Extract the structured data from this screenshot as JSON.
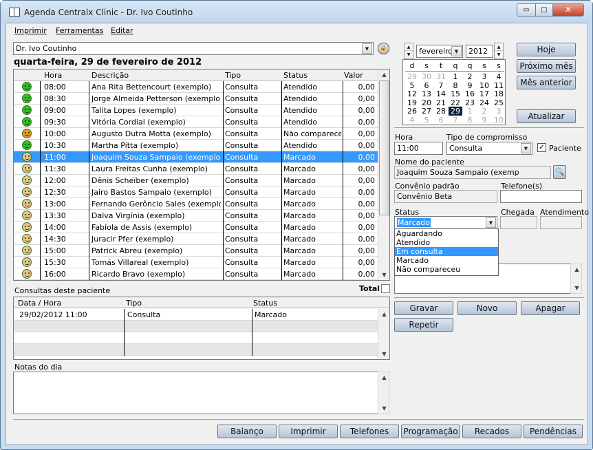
{
  "window": {
    "title": "Agenda Centralx Clinic -  Dr. Ivo Coutinho",
    "min_glyph": "▭",
    "max_glyph": "□",
    "close_glyph": "✕"
  },
  "menu": [
    "Imprimir",
    "Ferramentas",
    "Editar"
  ],
  "doctor_select": {
    "value": "Dr. Ivo Coutinho"
  },
  "date_heading": "quarta-feira, 29 de fevereiro de 2012",
  "appointments": {
    "columns": [
      "Hora",
      "Descrição",
      "Tipo",
      "Status",
      "Valor"
    ],
    "rows": [
      {
        "mood": "green",
        "hora": "08:00",
        "descricao": "Ana Rita Bettencourt (exemplo)",
        "tipo": "Consulta",
        "status": "Atendido",
        "valor": "0,00"
      },
      {
        "mood": "green",
        "hora": "08:30",
        "descricao": "Jorge Almeida Petterson (exemplo)",
        "tipo": "Consulta",
        "status": "Atendido",
        "valor": "0,00"
      },
      {
        "mood": "green",
        "hora": "09:00",
        "descricao": "Talita Lopes (exemplo)",
        "tipo": "Consulta",
        "status": "Atendido",
        "valor": "0,00"
      },
      {
        "mood": "green",
        "hora": "09:30",
        "descricao": "Vitória Cordial (exemplo)",
        "tipo": "Consulta",
        "status": "Atendido",
        "valor": "0,00"
      },
      {
        "mood": "orange",
        "hora": "10:00",
        "descricao": "Augusto Dutra Motta (exemplo)",
        "tipo": "Consulta",
        "status": "Não comparece",
        "valor": "0,00"
      },
      {
        "mood": "green",
        "hora": "10:30",
        "descricao": "Martha Pitta (exemplo)",
        "tipo": "Consulta",
        "status": "Atendido",
        "valor": "0,00"
      },
      {
        "mood": "beige",
        "hora": "11:00",
        "descricao": "Joaquim Souza Sampaio (exemplo)",
        "tipo": "Consulta",
        "status": "Marcado",
        "valor": "0,00",
        "selected": true
      },
      {
        "mood": "beige",
        "hora": "11:30",
        "descricao": "Laura Freitas Cunha (exemplo)",
        "tipo": "Consulta",
        "status": "Marcado",
        "valor": "0,00"
      },
      {
        "mood": "beige",
        "hora": "12:00",
        "descricao": "Dênis Scheïber (exemplo)",
        "tipo": "Consulta",
        "status": "Marcado",
        "valor": "0,00"
      },
      {
        "mood": "beige",
        "hora": "12:30",
        "descricao": "Jairo Bastos Sampaio (exemplo)",
        "tipo": "Consulta",
        "status": "Marcado",
        "valor": "0,00"
      },
      {
        "mood": "beige",
        "hora": "13:00",
        "descricao": "Fernando Gerôncio Sales (exemplo)",
        "tipo": "Consulta",
        "status": "Marcado",
        "valor": "0,00"
      },
      {
        "mood": "beige",
        "hora": "13:30",
        "descricao": "Dalva Virgínia (exemplo)",
        "tipo": "Consulta",
        "status": "Marcado",
        "valor": "0,00"
      },
      {
        "mood": "beige",
        "hora": "14:00",
        "descricao": "Fabíola de Assis (exemplo)",
        "tipo": "Consulta",
        "status": "Marcado",
        "valor": "0,00"
      },
      {
        "mood": "beige",
        "hora": "14:30",
        "descricao": "Juracir Pfer (exemplo)",
        "tipo": "Consulta",
        "status": "Marcado",
        "valor": "0,00"
      },
      {
        "mood": "beige",
        "hora": "15:00",
        "descricao": "Patrick Abreu (exemplo)",
        "tipo": "Consulta",
        "status": "Marcado",
        "valor": "0,00"
      },
      {
        "mood": "beige",
        "hora": "15:30",
        "descricao": "Tomás Villareal (exemplo)",
        "tipo": "Consulta",
        "status": "Marcado",
        "valor": "0,00"
      },
      {
        "mood": "beige",
        "hora": "16:00",
        "descricao": "Ricardo Bravo (exemplo)",
        "tipo": "Consulta",
        "status": "Marcado",
        "valor": "0,00"
      }
    ]
  },
  "patient_history": {
    "title": "Consultas deste paciente",
    "total_label": "Total",
    "columns": [
      "Data / Hora",
      "Tipo",
      "Status"
    ],
    "rows": [
      {
        "data": "29/02/2012 11:00",
        "tipo": "Consulta",
        "status": "Marcado"
      }
    ]
  },
  "notes": {
    "label": "Notas do dia",
    "value": ""
  },
  "calendar": {
    "month": "fevereiro",
    "year": "2012",
    "weekdays": [
      "d",
      "s",
      "t",
      "q",
      "q",
      "s",
      "s"
    ],
    "weeks": [
      [
        {
          "d": "29",
          "o": true
        },
        {
          "d": "30",
          "o": true
        },
        {
          "d": "31",
          "o": true
        },
        {
          "d": "1"
        },
        {
          "d": "2"
        },
        {
          "d": "3"
        },
        {
          "d": "4"
        }
      ],
      [
        {
          "d": "5"
        },
        {
          "d": "6"
        },
        {
          "d": "7"
        },
        {
          "d": "8"
        },
        {
          "d": "9"
        },
        {
          "d": "10"
        },
        {
          "d": "11"
        }
      ],
      [
        {
          "d": "12"
        },
        {
          "d": "13"
        },
        {
          "d": "14"
        },
        {
          "d": "15"
        },
        {
          "d": "16"
        },
        {
          "d": "17"
        },
        {
          "d": "18"
        }
      ],
      [
        {
          "d": "19"
        },
        {
          "d": "20"
        },
        {
          "d": "21"
        },
        {
          "d": "22"
        },
        {
          "d": "23"
        },
        {
          "d": "24"
        },
        {
          "d": "25"
        }
      ],
      [
        {
          "d": "26"
        },
        {
          "d": "27"
        },
        {
          "d": "28"
        },
        {
          "d": "29",
          "today": true
        },
        {
          "d": "1",
          "o": true
        },
        {
          "d": "2",
          "o": true
        },
        {
          "d": "3",
          "o": true
        }
      ],
      [
        {
          "d": "4",
          "o": true
        },
        {
          "d": "5",
          "o": true
        },
        {
          "d": "6",
          "o": true
        },
        {
          "d": "7",
          "o": true
        },
        {
          "d": "8",
          "o": true
        },
        {
          "d": "9",
          "o": true
        },
        {
          "d": "10",
          "o": true
        }
      ]
    ]
  },
  "nav_buttons": {
    "hoje": "Hoje",
    "proximo": "Próximo mês",
    "anterior": "Mês anterior",
    "atualizar": "Atualizar"
  },
  "form": {
    "hora_label": "Hora",
    "hora_value": "11:00",
    "tipo_label": "Tipo de compromisso",
    "tipo_value": "Consulta",
    "paciente_label": "Paciente",
    "paciente_checked": "✓",
    "nome_label": "Nome do paciente",
    "nome_value": "Joaquim Souza Sampaio (exemp",
    "convenio_label": "Convênio padrão",
    "convenio_value": "Convênio Beta",
    "telefone_label": "Telefone(s)",
    "telefone_value": "",
    "status_label": "Status",
    "status_value": "Marcado",
    "chegada_label": "Chegada",
    "atendimento_label": "Atendimento",
    "status_options": [
      "Aguardando",
      "Atendido",
      "Em consulta",
      "Marcado",
      "Não compareceu"
    ],
    "status_highlight": "Em consulta"
  },
  "action_buttons": {
    "gravar": "Gravar",
    "novo": "Novo",
    "apagar": "Apagar",
    "repetir": "Repetir"
  },
  "bottom_buttons": [
    "Balanço",
    "Imprimir",
    "Telefones",
    "Programação",
    "Recados",
    "Pendências"
  ],
  "mood_colors": {
    "green": "#2fbf2a",
    "orange": "#e89a1c",
    "beige": "#e8c58c"
  }
}
